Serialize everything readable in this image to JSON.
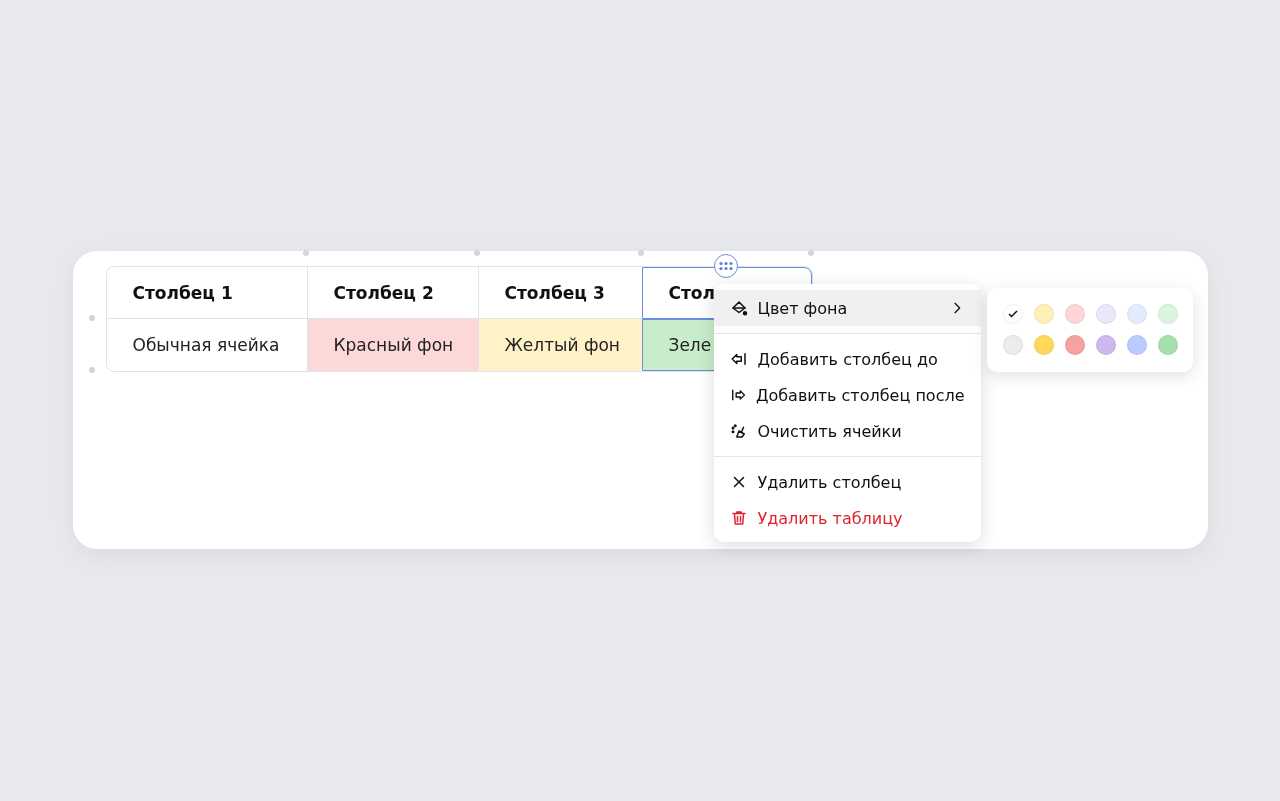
{
  "table": {
    "columns": [
      {
        "label": "Столбец 1",
        "selected": false
      },
      {
        "label": "Столбец 2",
        "selected": false
      },
      {
        "label": "Столбец 3",
        "selected": false
      },
      {
        "label": "Стол",
        "selected": true
      }
    ],
    "rows": [
      {
        "cells": [
          {
            "text": "Обычная ячейка",
            "color": "#ffffff"
          },
          {
            "text": "Красный фон",
            "color": "#fdd8d8"
          },
          {
            "text": "Желтый фон",
            "color": "#fff1c8"
          },
          {
            "text": "Зеле",
            "color": "#c9edcb"
          }
        ]
      }
    ]
  },
  "context_menu": {
    "groups": [
      [
        {
          "label": "Цвет фона",
          "kind": "submenu",
          "highlighted": true
        }
      ],
      [
        {
          "label": "Добавить столбец до",
          "kind": "action",
          "highlighted": false
        },
        {
          "label": "Добавить столбец после",
          "kind": "action",
          "highlighted": false
        },
        {
          "label": "Очистить ячейки",
          "kind": "action",
          "highlighted": false
        }
      ],
      [
        {
          "label": "Удалить столбец",
          "kind": "action",
          "highlighted": false
        },
        {
          "label": "Удалить таблицу",
          "kind": "danger",
          "highlighted": false
        }
      ]
    ]
  },
  "color_palette": {
    "rows": [
      [
        {
          "color": "#ffffff",
          "selected": true
        },
        {
          "color": "#fff0b8",
          "selected": false
        },
        {
          "color": "#ffd6d6",
          "selected": false
        },
        {
          "color": "#ece6fa",
          "selected": false
        },
        {
          "color": "#e3ebff",
          "selected": false
        },
        {
          "color": "#dcf5de",
          "selected": false
        }
      ],
      [
        {
          "color": "#ececec",
          "selected": false
        },
        {
          "color": "#ffd95a",
          "selected": false
        },
        {
          "color": "#f7a1a1",
          "selected": false
        },
        {
          "color": "#cdb8f0",
          "selected": false
        },
        {
          "color": "#b9cbff",
          "selected": false
        },
        {
          "color": "#a6dfa8",
          "selected": false
        }
      ]
    ]
  }
}
